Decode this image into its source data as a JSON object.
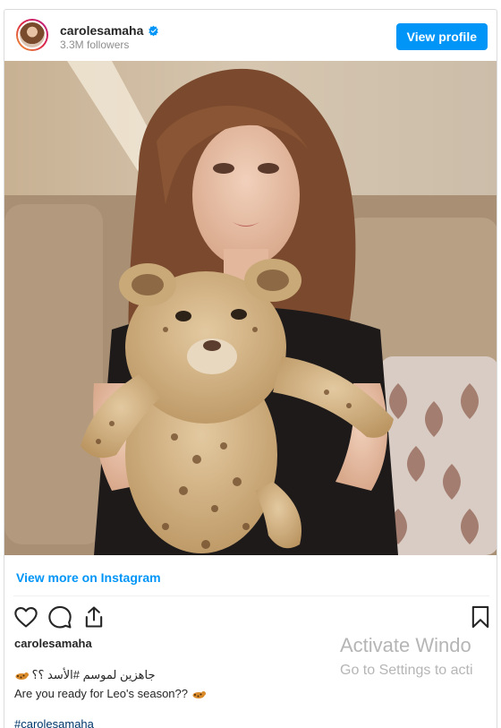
{
  "post": {
    "username": "carolesamaha",
    "followers": "3.3M followers",
    "view_profile_label": "View profile",
    "view_more_label": "View more on Instagram",
    "caption_username": "carolesamaha",
    "caption_arabic": "جاهزين لموسم #الأسد ؟؟",
    "caption_english": "Are you ready for Leo's season??",
    "hashtag": "#carolesamaha"
  },
  "icons": {
    "verified": "verified-badge-icon",
    "like": "heart-icon",
    "comment": "comment-icon",
    "share": "share-icon",
    "save": "bookmark-icon",
    "cub_emoji": "lion-cub-emoji-icon"
  },
  "colors": {
    "brand_blue": "#0095f6",
    "text": "#262626",
    "muted": "#8e8e8e"
  },
  "windows_watermark": {
    "line1": "Activate Windo",
    "line2": "Go to Settings to acti"
  }
}
